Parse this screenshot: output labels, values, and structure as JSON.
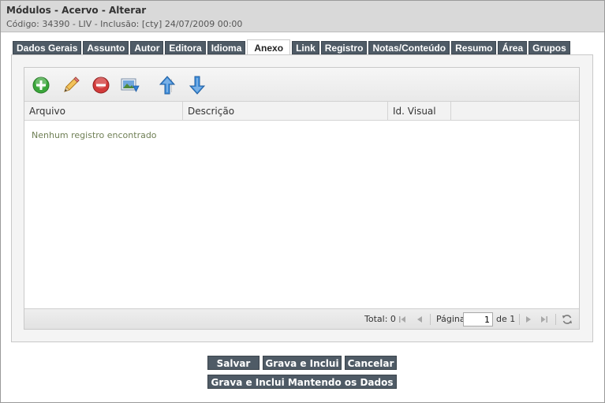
{
  "header": {
    "title": "Módulos - Acervo - Alterar",
    "subtitle": "Código: 34390 - LIV - Inclusão: [cty] 24/07/2009 00:00"
  },
  "tabs": [
    {
      "label": "Dados Gerais",
      "active": false
    },
    {
      "label": "Assunto",
      "active": false
    },
    {
      "label": "Autor",
      "active": false
    },
    {
      "label": "Editora",
      "active": false
    },
    {
      "label": "Idioma",
      "active": false
    },
    {
      "label": "Anexo",
      "active": true
    },
    {
      "label": "Link",
      "active": false
    },
    {
      "label": "Registro",
      "active": false
    },
    {
      "label": "Notas/Conteúdo",
      "active": false
    },
    {
      "label": "Resumo",
      "active": false
    },
    {
      "label": "Área",
      "active": false
    },
    {
      "label": "Grupos",
      "active": false
    }
  ],
  "toolbar": {
    "icons": [
      "add-icon",
      "edit-pencil-icon",
      "delete-icon",
      "import-image-icon",
      "move-up-arrow-icon",
      "move-down-arrow-icon"
    ]
  },
  "grid": {
    "columns": [
      "Arquivo",
      "Descrição",
      "Id. Visual"
    ],
    "empty_message": "Nenhum registro encontrado"
  },
  "pager": {
    "total_label": "Total: 0",
    "page_label": "Página",
    "page_value": "1",
    "of_label": "de 1"
  },
  "buttons": {
    "save": "Salvar",
    "save_and_add": "Grava e Inclui",
    "cancel": "Cancelar",
    "save_add_keep": "Grava e Inclui Mantendo os Dados"
  },
  "colors": {
    "tab_bg": "#4f5b66",
    "header_bg": "#d9d9d9",
    "add_green": "#3aa63a",
    "delete_red": "#d23a3a",
    "arrow_blue": "#3f8fdc"
  }
}
